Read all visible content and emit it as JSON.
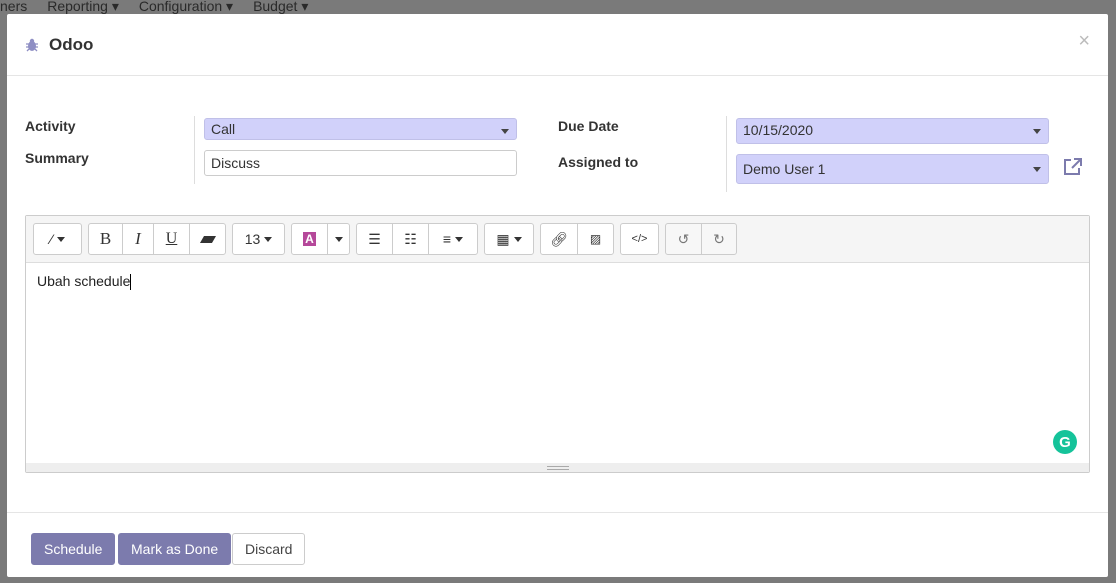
{
  "background_menu": [
    "ners",
    "Reporting ▾",
    "Configuration ▾",
    "Budget ▾"
  ],
  "modal": {
    "title": "Odoo",
    "close": "×"
  },
  "form": {
    "activity_label": "Activity",
    "activity_value": "Call",
    "summary_label": "Summary",
    "summary_value": "Discuss",
    "due_date_label": "Due Date",
    "due_date_value": "10/15/2020",
    "assigned_label": "Assigned to",
    "assigned_value": "Demo User 1"
  },
  "toolbar": {
    "font_size": "13",
    "bold": "B",
    "italic": "I",
    "underline": "U",
    "color_letter": "A"
  },
  "editor": {
    "content": "Ubah schedule",
    "grammarly": "G"
  },
  "footer": {
    "schedule": "Schedule",
    "mark_done": "Mark as Done",
    "discard": "Discard"
  },
  "colors": {
    "primary": "#7c7bad",
    "select_bg": "#d1d1fa",
    "grammarly": "#15c39a"
  }
}
